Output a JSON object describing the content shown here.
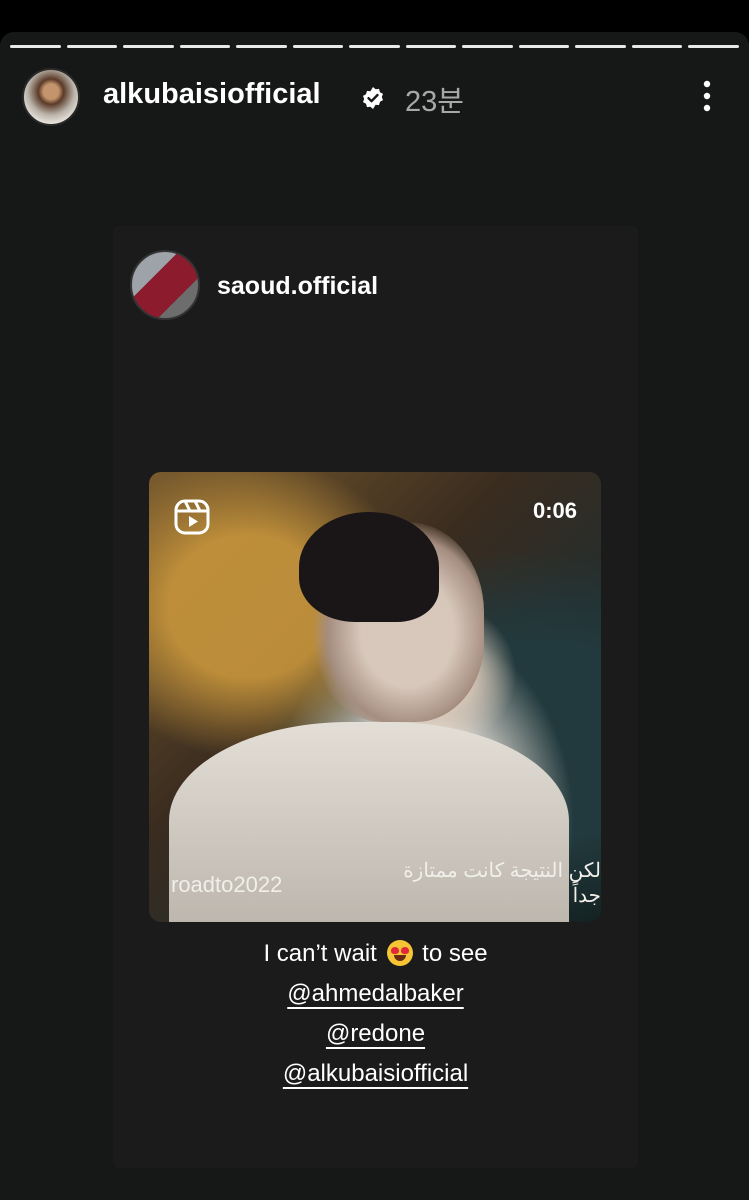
{
  "header": {
    "username": "alkubaisiofficial",
    "time": "23분",
    "verified_icon": "verified-badge-icon",
    "more_icon": "more-vertical-icon"
  },
  "progress": {
    "segments": 13
  },
  "shared_post": {
    "username": "saoud.official",
    "video": {
      "duration": "0:06",
      "subtitle": "لكن النتيجة كانت ممتازة جداً",
      "hashtag": "roadto2022",
      "icon": "reels-icon"
    }
  },
  "caption": {
    "text_before": "I can’t wait",
    "emoji": "heart-eyes-emoji",
    "text_after": "to see",
    "mentions": [
      "@ahmedalbaker",
      "@redone",
      "@alkubaisiofficial"
    ]
  },
  "colors": {
    "background": "#161817",
    "card": "#1b1b1c",
    "text": "#ffffff",
    "muted": "#a8a8a8"
  }
}
